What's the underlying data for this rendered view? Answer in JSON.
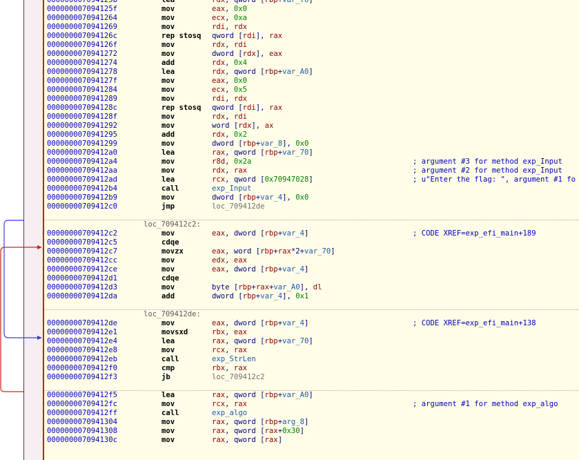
{
  "listing": [
    {
      "kind": "ins",
      "addr": "000000007094125b",
      "mn": "lea",
      "ops": [
        [
          "r",
          "rdx"
        ],
        [
          "t",
          ", qword ["
        ],
        [
          "r",
          "rbp"
        ],
        [
          "t",
          "+"
        ],
        [
          "d",
          "var_70"
        ],
        [
          "t",
          "]"
        ]
      ]
    },
    {
      "kind": "ins",
      "addr": "000000007094125f",
      "mn": "mov",
      "ops": [
        [
          "r",
          "eax"
        ],
        [
          "t",
          ", "
        ],
        [
          "n",
          "0x0"
        ]
      ]
    },
    {
      "kind": "ins",
      "addr": "0000000070941264",
      "mn": "mov",
      "ops": [
        [
          "r",
          "ecx"
        ],
        [
          "t",
          ", "
        ],
        [
          "n",
          "0xa"
        ]
      ]
    },
    {
      "kind": "ins",
      "addr": "0000000070941269",
      "mn": "mov",
      "ops": [
        [
          "r",
          "rdi"
        ],
        [
          "t",
          ", "
        ],
        [
          "r",
          "rdx"
        ]
      ]
    },
    {
      "kind": "ins",
      "addr": "000000007094126c",
      "mn": "rep stosq",
      "ops": [
        [
          "t",
          "qword ["
        ],
        [
          "r",
          "rdi"
        ],
        [
          "t",
          "], "
        ],
        [
          "r",
          "rax"
        ]
      ]
    },
    {
      "kind": "ins",
      "addr": "000000007094126f",
      "mn": "mov",
      "ops": [
        [
          "r",
          "rdx"
        ],
        [
          "t",
          ", "
        ],
        [
          "r",
          "rdi"
        ]
      ]
    },
    {
      "kind": "ins",
      "addr": "0000000070941272",
      "mn": "mov",
      "ops": [
        [
          "t",
          "dword ["
        ],
        [
          "r",
          "rdx"
        ],
        [
          "t",
          "], "
        ],
        [
          "r",
          "eax"
        ]
      ]
    },
    {
      "kind": "ins",
      "addr": "0000000070941274",
      "mn": "add",
      "ops": [
        [
          "r",
          "rdx"
        ],
        [
          "t",
          ", "
        ],
        [
          "n",
          "0x4"
        ]
      ]
    },
    {
      "kind": "ins",
      "addr": "0000000070941278",
      "mn": "lea",
      "ops": [
        [
          "r",
          "rdx"
        ],
        [
          "t",
          ", qword ["
        ],
        [
          "r",
          "rbp"
        ],
        [
          "t",
          "+"
        ],
        [
          "d",
          "var_A0"
        ],
        [
          "t",
          "]"
        ]
      ]
    },
    {
      "kind": "ins",
      "addr": "000000007094127f",
      "mn": "mov",
      "ops": [
        [
          "r",
          "eax"
        ],
        [
          "t",
          ", "
        ],
        [
          "n",
          "0x0"
        ]
      ]
    },
    {
      "kind": "ins",
      "addr": "0000000070941284",
      "mn": "mov",
      "ops": [
        [
          "r",
          "ecx"
        ],
        [
          "t",
          ", "
        ],
        [
          "n",
          "0x5"
        ]
      ]
    },
    {
      "kind": "ins",
      "addr": "0000000070941289",
      "mn": "mov",
      "ops": [
        [
          "r",
          "rdi"
        ],
        [
          "t",
          ", "
        ],
        [
          "r",
          "rdx"
        ]
      ]
    },
    {
      "kind": "ins",
      "addr": "000000007094128c",
      "mn": "rep stosq",
      "ops": [
        [
          "t",
          "qword ["
        ],
        [
          "r",
          "rdi"
        ],
        [
          "t",
          "], "
        ],
        [
          "r",
          "rax"
        ]
      ]
    },
    {
      "kind": "ins",
      "addr": "000000007094128f",
      "mn": "mov",
      "ops": [
        [
          "r",
          "rdx"
        ],
        [
          "t",
          ", "
        ],
        [
          "r",
          "rdi"
        ]
      ]
    },
    {
      "kind": "ins",
      "addr": "0000000070941292",
      "mn": "mov",
      "ops": [
        [
          "t",
          "word ["
        ],
        [
          "r",
          "rdx"
        ],
        [
          "t",
          "], "
        ],
        [
          "r",
          "ax"
        ]
      ]
    },
    {
      "kind": "ins",
      "addr": "0000000070941295",
      "mn": "add",
      "ops": [
        [
          "r",
          "rdx"
        ],
        [
          "t",
          ", "
        ],
        [
          "n",
          "0x2"
        ]
      ]
    },
    {
      "kind": "ins",
      "addr": "0000000070941299",
      "mn": "mov",
      "ops": [
        [
          "t",
          "dword ["
        ],
        [
          "r",
          "rbp"
        ],
        [
          "t",
          "+"
        ],
        [
          "d",
          "var_8"
        ],
        [
          "t",
          "], "
        ],
        [
          "n",
          "0x0"
        ]
      ]
    },
    {
      "kind": "ins",
      "addr": "00000000709412a0",
      "mn": "lea",
      "ops": [
        [
          "r",
          "rax"
        ],
        [
          "t",
          ", qword ["
        ],
        [
          "r",
          "rbp"
        ],
        [
          "t",
          "+"
        ],
        [
          "d",
          "var_70"
        ],
        [
          "t",
          "]"
        ]
      ]
    },
    {
      "kind": "ins",
      "addr": "00000000709412a4",
      "mn": "mov",
      "ops": [
        [
          "r",
          "r8d"
        ],
        [
          "t",
          ", "
        ],
        [
          "n",
          "0x2a"
        ]
      ],
      "comment": "; argument #3 for method exp_Input"
    },
    {
      "kind": "ins",
      "addr": "00000000709412aa",
      "mn": "mov",
      "ops": [
        [
          "r",
          "rdx"
        ],
        [
          "t",
          ", "
        ],
        [
          "r",
          "rax"
        ]
      ],
      "comment": "; argument #2 for method exp_Input"
    },
    {
      "kind": "ins",
      "addr": "00000000709412ad",
      "mn": "lea",
      "ops": [
        [
          "r",
          "rcx"
        ],
        [
          "t",
          ", qword ["
        ],
        [
          "n",
          "0x70947028"
        ],
        [
          "t",
          "]"
        ]
      ],
      "comment": "; u\"Enter the flag: \", argument #1 fo"
    },
    {
      "kind": "ins",
      "addr": "00000000709412b4",
      "mn": "call",
      "ops": [
        [
          "d",
          "exp_Input"
        ]
      ]
    },
    {
      "kind": "ins",
      "addr": "00000000709412b9",
      "mn": "mov",
      "ops": [
        [
          "t",
          "dword ["
        ],
        [
          "r",
          "rbp"
        ],
        [
          "t",
          "+"
        ],
        [
          "d",
          "var_4"
        ],
        [
          "t",
          "], "
        ],
        [
          "n",
          "0x0"
        ]
      ]
    },
    {
      "kind": "ins",
      "addr": "00000000709412c0",
      "mn": "jmp",
      "ops": [
        [
          "l",
          "loc_709412de"
        ]
      ]
    },
    {
      "kind": "sep"
    },
    {
      "kind": "label",
      "text": "loc_709412c2:"
    },
    {
      "kind": "ins",
      "addr": "00000000709412c2",
      "mn": "mov",
      "ops": [
        [
          "r",
          "eax"
        ],
        [
          "t",
          ", dword ["
        ],
        [
          "r",
          "rbp"
        ],
        [
          "t",
          "+"
        ],
        [
          "d",
          "var_4"
        ],
        [
          "t",
          "]"
        ]
      ],
      "comment": "; CODE XREF=exp_efi_main+189"
    },
    {
      "kind": "ins",
      "addr": "00000000709412c5",
      "mn": "cdqe",
      "ops": []
    },
    {
      "kind": "ins",
      "addr": "00000000709412c7",
      "mn": "movzx",
      "ops": [
        [
          "r",
          "eax"
        ],
        [
          "t",
          ", word ["
        ],
        [
          "r",
          "rbp"
        ],
        [
          "t",
          "+"
        ],
        [
          "r",
          "rax"
        ],
        [
          "t",
          "*2+"
        ],
        [
          "d",
          "var_70"
        ],
        [
          "t",
          "]"
        ]
      ]
    },
    {
      "kind": "ins",
      "addr": "00000000709412cc",
      "mn": "mov",
      "ops": [
        [
          "r",
          "edx"
        ],
        [
          "t",
          ", "
        ],
        [
          "r",
          "eax"
        ]
      ]
    },
    {
      "kind": "ins",
      "addr": "00000000709412ce",
      "mn": "mov",
      "ops": [
        [
          "r",
          "eax"
        ],
        [
          "t",
          ", dword ["
        ],
        [
          "r",
          "rbp"
        ],
        [
          "t",
          "+"
        ],
        [
          "d",
          "var_4"
        ],
        [
          "t",
          "]"
        ]
      ]
    },
    {
      "kind": "ins",
      "addr": "00000000709412d1",
      "mn": "cdqe",
      "ops": []
    },
    {
      "kind": "ins",
      "addr": "00000000709412d3",
      "mn": "mov",
      "ops": [
        [
          "t",
          "byte ["
        ],
        [
          "r",
          "rbp"
        ],
        [
          "t",
          "+"
        ],
        [
          "r",
          "rax"
        ],
        [
          "t",
          "+"
        ],
        [
          "d",
          "var_A0"
        ],
        [
          "t",
          "], "
        ],
        [
          "r",
          "dl"
        ]
      ]
    },
    {
      "kind": "ins",
      "addr": "00000000709412da",
      "mn": "add",
      "ops": [
        [
          "t",
          "dword ["
        ],
        [
          "r",
          "rbp"
        ],
        [
          "t",
          "+"
        ],
        [
          "d",
          "var_4"
        ],
        [
          "t",
          "], "
        ],
        [
          "n",
          "0x1"
        ]
      ]
    },
    {
      "kind": "sep"
    },
    {
      "kind": "label",
      "text": "loc_709412de:"
    },
    {
      "kind": "ins",
      "addr": "00000000709412de",
      "mn": "mov",
      "ops": [
        [
          "r",
          "eax"
        ],
        [
          "t",
          ", dword ["
        ],
        [
          "r",
          "rbp"
        ],
        [
          "t",
          "+"
        ],
        [
          "d",
          "var_4"
        ],
        [
          "t",
          "]"
        ]
      ],
      "comment": "; CODE XREF=exp_efi_main+138"
    },
    {
      "kind": "ins",
      "addr": "00000000709412e1",
      "mn": "movsxd",
      "ops": [
        [
          "r",
          "rbx"
        ],
        [
          "t",
          ", "
        ],
        [
          "r",
          "eax"
        ]
      ]
    },
    {
      "kind": "ins",
      "addr": "00000000709412e4",
      "mn": "lea",
      "ops": [
        [
          "r",
          "rax"
        ],
        [
          "t",
          ", qword ["
        ],
        [
          "r",
          "rbp"
        ],
        [
          "t",
          "+"
        ],
        [
          "d",
          "var_70"
        ],
        [
          "t",
          "]"
        ]
      ]
    },
    {
      "kind": "ins",
      "addr": "00000000709412e8",
      "mn": "mov",
      "ops": [
        [
          "r",
          "rcx"
        ],
        [
          "t",
          ", "
        ],
        [
          "r",
          "rax"
        ]
      ]
    },
    {
      "kind": "ins",
      "addr": "00000000709412eb",
      "mn": "call",
      "ops": [
        [
          "d",
          "exp_StrLen"
        ]
      ]
    },
    {
      "kind": "ins",
      "addr": "00000000709412f0",
      "mn": "cmp",
      "ops": [
        [
          "r",
          "rbx"
        ],
        [
          "t",
          ", "
        ],
        [
          "r",
          "rax"
        ]
      ]
    },
    {
      "kind": "ins",
      "addr": "00000000709412f3",
      "mn": "jb",
      "ops": [
        [
          "l",
          "loc_709412c2"
        ]
      ]
    },
    {
      "kind": "sep"
    },
    {
      "kind": "ins",
      "addr": "00000000709412f5",
      "mn": "lea",
      "ops": [
        [
          "r",
          "rax"
        ],
        [
          "t",
          ", qword ["
        ],
        [
          "r",
          "rbp"
        ],
        [
          "t",
          "+"
        ],
        [
          "d",
          "var_A0"
        ],
        [
          "t",
          "]"
        ]
      ]
    },
    {
      "kind": "ins",
      "addr": "00000000709412fc",
      "mn": "mov",
      "ops": [
        [
          "r",
          "rcx"
        ],
        [
          "t",
          ", "
        ],
        [
          "r",
          "rax"
        ]
      ],
      "comment": "; argument #1 for method exp_algo"
    },
    {
      "kind": "ins",
      "addr": "00000000709412ff",
      "mn": "call",
      "ops": [
        [
          "d",
          "exp_algo"
        ]
      ]
    },
    {
      "kind": "ins",
      "addr": "0000000070941304",
      "mn": "mov",
      "ops": [
        [
          "r",
          "rax"
        ],
        [
          "t",
          ", qword ["
        ],
        [
          "r",
          "rbp"
        ],
        [
          "t",
          "+"
        ],
        [
          "d",
          "arg_8"
        ],
        [
          "t",
          "]"
        ]
      ]
    },
    {
      "kind": "ins",
      "addr": "0000000070941308",
      "mn": "mov",
      "ops": [
        [
          "r",
          "rax"
        ],
        [
          "t",
          ", qword ["
        ],
        [
          "r",
          "rax"
        ],
        [
          "t",
          "+"
        ],
        [
          "n",
          "0x30"
        ],
        [
          "t",
          "]"
        ]
      ]
    },
    {
      "kind": "ins",
      "addr": "000000007094130c",
      "mn": "mov",
      "ops": [
        [
          "r",
          "rax"
        ],
        [
          "t",
          ", qword ["
        ],
        [
          "r",
          "rax"
        ],
        [
          "t",
          "]"
        ]
      ]
    }
  ],
  "colors": {
    "address": "#0000b8",
    "mnemonic": "#000000",
    "register": "#8b0000",
    "number": "#008000",
    "data_ref": "#1e5aa8",
    "label": "#707070",
    "comment": "#0000b8",
    "divider": "#e00000",
    "arrow_forward": "#3b3bd6",
    "arrow_loop": "#d42020"
  }
}
